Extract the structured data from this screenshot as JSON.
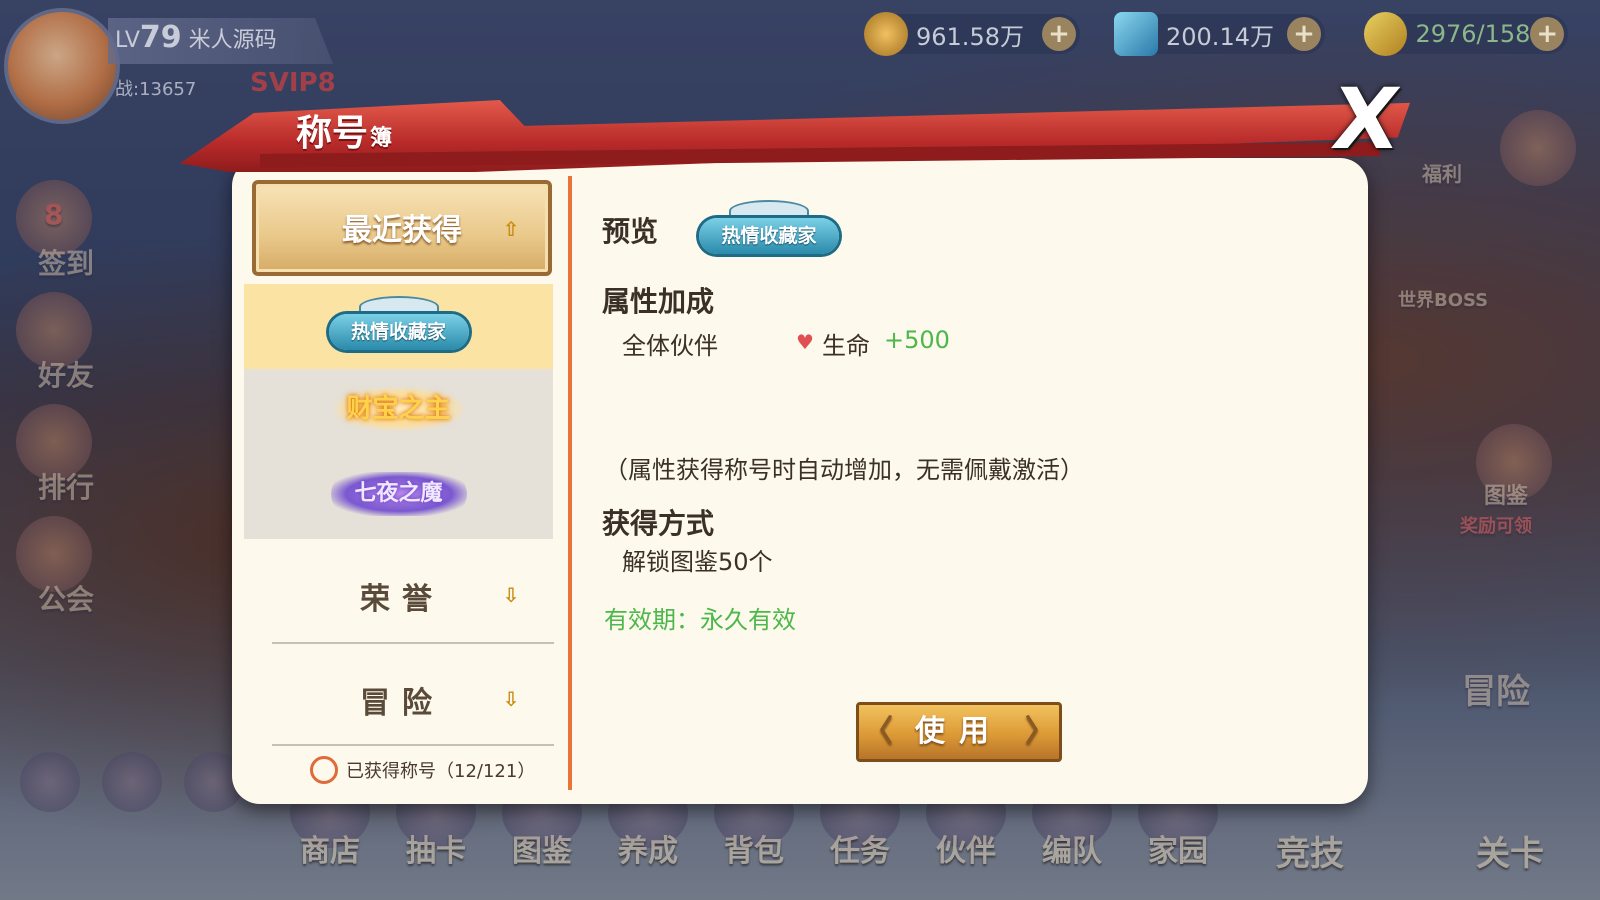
{
  "player": {
    "level_prefix": "LV",
    "level": "79",
    "name": "米人源码",
    "power": "战:13657",
    "vip": "SVIP8"
  },
  "resources": {
    "gold": "961.58万",
    "diamond": "200.14万",
    "stamina": "2976/158"
  },
  "background_labels": {
    "left": [
      "签到",
      "好友",
      "排行",
      "公会"
    ],
    "left_badge": "8",
    "right": [
      "福利",
      "世界BOSS",
      "图鉴",
      "奖励可领",
      "冒险"
    ],
    "bottom": [
      "商店",
      "抽卡",
      "图鉴",
      "养成",
      "背包",
      "任务",
      "伙伴",
      "编队",
      "家园",
      "竞技",
      "关卡"
    ]
  },
  "modal": {
    "title": "称号",
    "title_small": "簿",
    "close": "X",
    "categories": {
      "recent": "最近获得",
      "honor": "荣誉",
      "adventure": "冒险"
    },
    "titles": [
      {
        "name": "热情收藏家",
        "style": "blue",
        "selected": true
      },
      {
        "name": "财宝之主",
        "style": "gold",
        "selected": false
      },
      {
        "name": "七夜之魔",
        "style": "purple",
        "selected": false
      }
    ],
    "owned_count": "已获得称号（12/121）",
    "preview_label": "预览",
    "preview_badge": "热情收藏家",
    "attr_heading": "属性加成",
    "attr_target": "全体伙伴",
    "attr_name": "生命",
    "attr_value": "+500",
    "attr_note": "（属性获得称号时自动增加，无需佩戴激活）",
    "obtain_heading": "获得方式",
    "obtain_method": "解锁图鉴50个",
    "validity": "有效期：永久有效",
    "use_button": "使用"
  },
  "colors": {
    "panel": "#fdf9ec",
    "header_red": "#b82a2a",
    "accent_orange": "#e8743a",
    "green": "#4cb84a",
    "selected_row": "#fbe3a4"
  }
}
